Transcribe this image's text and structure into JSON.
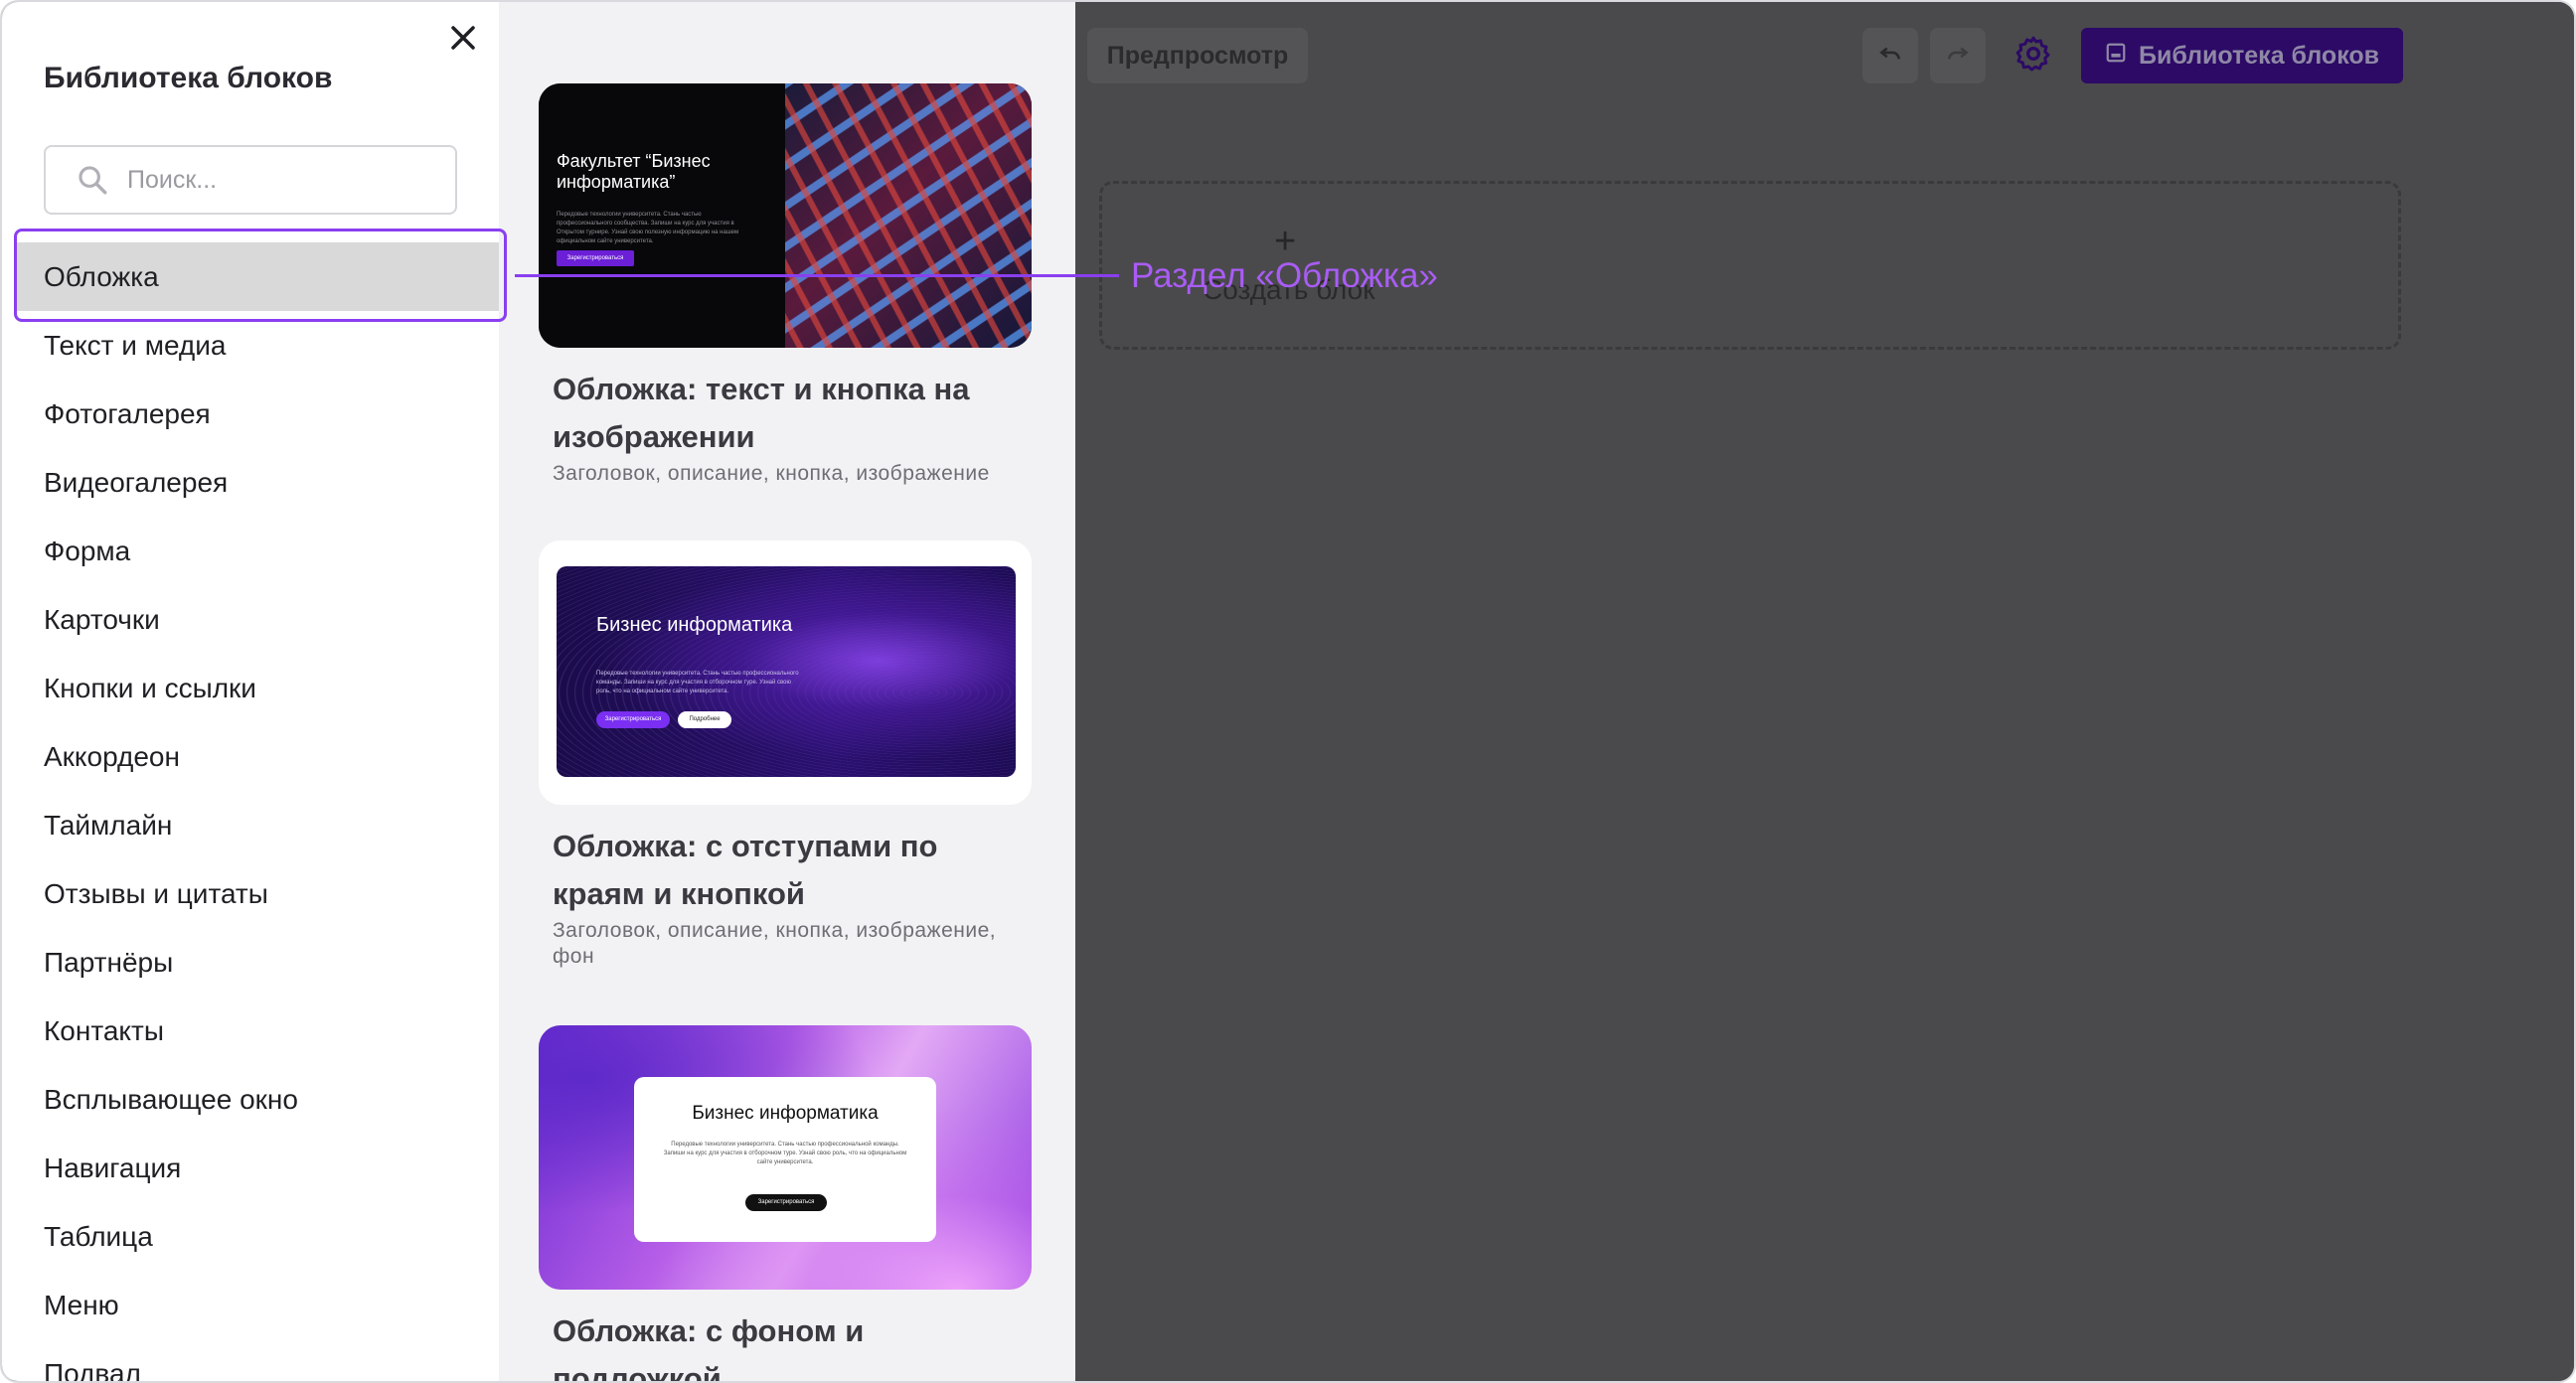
{
  "sidebar": {
    "title": "Библиотека блоков",
    "search_placeholder": "Поиск...",
    "items": [
      {
        "label": "Обложка"
      },
      {
        "label": "Текст и медиа"
      },
      {
        "label": "Фотогалерея"
      },
      {
        "label": "Видеогалерея"
      },
      {
        "label": "Форма"
      },
      {
        "label": "Карточки"
      },
      {
        "label": "Кнопки и ссылки"
      },
      {
        "label": "Аккордеон"
      },
      {
        "label": "Таймлайн"
      },
      {
        "label": "Отзывы и цитаты"
      },
      {
        "label": "Партнёры"
      },
      {
        "label": "Контакты"
      },
      {
        "label": "Всплывающее окно"
      },
      {
        "label": "Навигация"
      },
      {
        "label": "Таблица"
      },
      {
        "label": "Меню"
      },
      {
        "label": "Подвал"
      }
    ],
    "active_index": 0
  },
  "templates": [
    {
      "title": "Обложка: текст и кнопка на изображении",
      "tags": "Заголовок, описание, кнопка, изображение",
      "preview": {
        "heading": "Факультет “Бизнес информатика”",
        "body": "Передовые технологии университета. Стань частью профессионального сообщества. Запиши на курс для участия в Открытом турнире. Узнай свою полезную информацию на нашем официальном сайте университета.",
        "button": "Зарегистрироваться"
      }
    },
    {
      "title": "Обложка: с отступами по краям и кнопкой",
      "tags": "Заголовок, описание, кнопка, изображение, фон",
      "preview": {
        "heading": "Бизнес информатика",
        "body": "Передовые технологии университета. Стань частью профессионального команды. Запиши на курс для участия в отборочном туре. Узнай свою роль, что на официальном сайте университета.",
        "button_primary": "Зарегистрироваться",
        "button_secondary": "Подробнее"
      }
    },
    {
      "title": "Обложка: с фоном и подложкой",
      "tags": "",
      "preview": {
        "heading": "Бизнес информатика",
        "body": "Передовые технологии университета. Стань частью профессиональной команды. Запиши на курс для участия в отборочном туре. Узнай свою роль, что на официальном сайте университета.",
        "button": "Зарегистрироваться"
      }
    }
  ],
  "editor": {
    "preview_label": "Предпросмотр",
    "library_label": "Библиотека блоков",
    "create_block_label": "Создать блок",
    "create_plus": "+"
  },
  "annotation": {
    "text": "Раздел «Обложка»",
    "color": "#a95cf5"
  },
  "colors": {
    "accent": "#8a3ff0",
    "library_button": "#2c0a66",
    "overlay": "#4a4a4c"
  },
  "icons": {
    "close": "close-icon",
    "search": "search-icon",
    "undo": "undo-icon",
    "redo": "redo-icon",
    "settings": "gear-icon",
    "library": "library-icon"
  }
}
